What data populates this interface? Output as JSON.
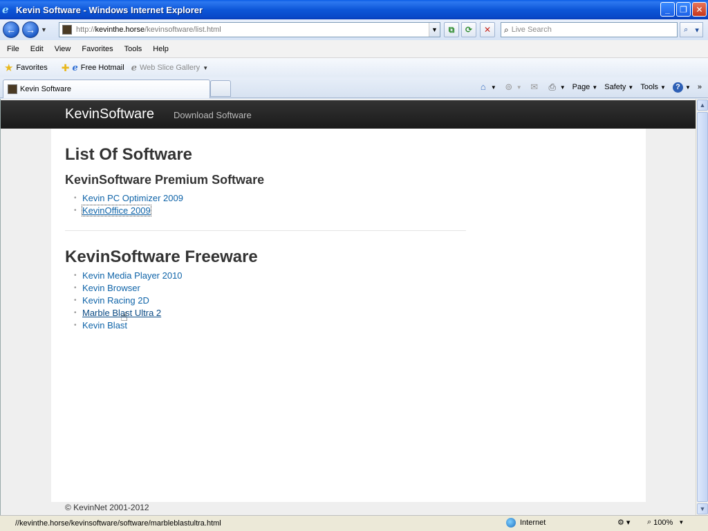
{
  "window": {
    "title": "Kevin Software - Windows Internet Explorer",
    "controls": {
      "minimize": "_",
      "maximize": "❐",
      "close": "✕"
    }
  },
  "address_bar": {
    "url_prefix": "http://",
    "url_host": "kevinthe.horse",
    "url_path": "/kevinsoftware/list.html",
    "search_placeholder": "Live Search"
  },
  "menu": [
    "File",
    "Edit",
    "View",
    "Favorites",
    "Tools",
    "Help"
  ],
  "favorites_bar": {
    "favorites_label": "Favorites",
    "items": [
      "Free Hotmail",
      "Web Slice Gallery"
    ]
  },
  "tab": {
    "title": "Kevin Software"
  },
  "command_bar": {
    "page": "Page",
    "safety": "Safety",
    "tools": "Tools"
  },
  "site": {
    "brand": "KevinSoftware",
    "nav_link": "Download Software",
    "heading": "List Of Software",
    "premium_heading": "KevinSoftware Premium Software",
    "premium_items": [
      "Kevin PC Optimizer 2009",
      "KevinOffice 2009"
    ],
    "freeware_heading": "KevinSoftware Freeware",
    "freeware_items": [
      "Kevin Media Player 2010",
      "Kevin Browser",
      "Kevin Racing 2D",
      "Marble Blast Ultra 2",
      "Kevin Blast"
    ],
    "footer": "© KevinNet 2001-2012"
  },
  "status_bar": {
    "url": "//kevinthe.horse/kevinsoftware/software/marbleblastultra.html",
    "zone": "Internet",
    "zoom": "100%"
  },
  "colors": {
    "link": "#0e63a8",
    "nav_bg": "#222222",
    "title_bar": "#0a5ce6"
  }
}
